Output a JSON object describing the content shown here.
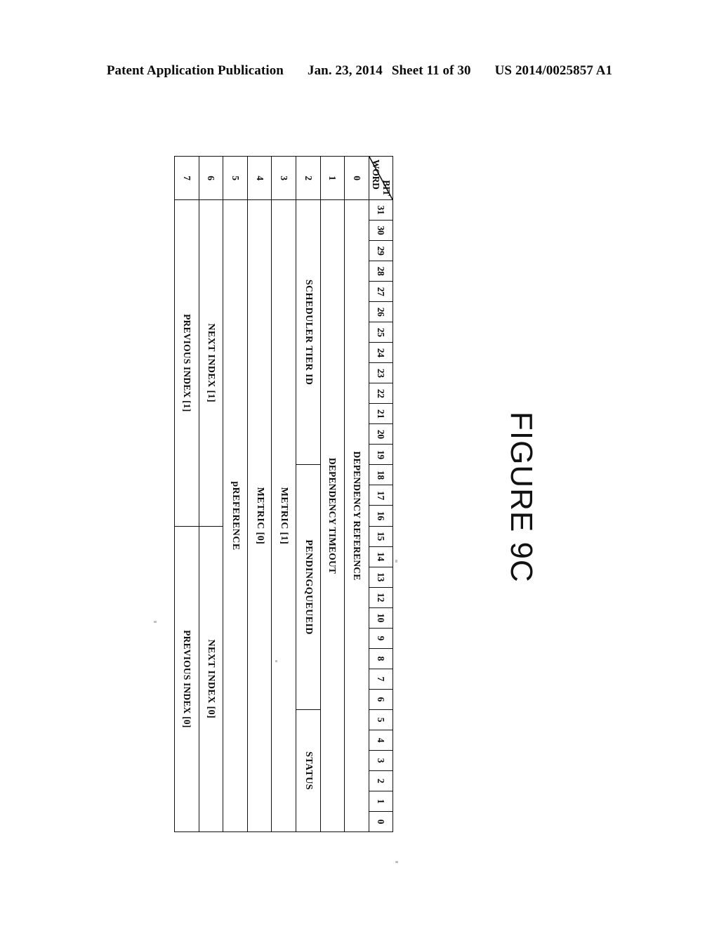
{
  "header": {
    "publication": "Patent Application Publication",
    "date": "Jan. 23, 2014",
    "sheet": "Sheet 11 of 30",
    "patent_number": "US 2014/0025857 A1"
  },
  "figure": {
    "caption": "FIGURE 9C",
    "axis_labels": {
      "word": "WORD",
      "bit": "BIT"
    },
    "bit_numbers": [
      "31",
      "30",
      "29",
      "28",
      "27",
      "26",
      "25",
      "24",
      "23",
      "22",
      "21",
      "20",
      "19",
      "18",
      "17",
      "16",
      "15",
      "14",
      "13",
      "12",
      "10",
      "9",
      "8",
      "7",
      "6",
      "5",
      "4",
      "3",
      "2",
      "1",
      "0"
    ],
    "words": [
      "0",
      "1",
      "2",
      "3",
      "4",
      "5",
      "6",
      "7"
    ],
    "rows": [
      {
        "word": "0",
        "fields": [
          {
            "label": "DEPENDENCY REFERENCE",
            "span": 31
          }
        ]
      },
      {
        "word": "1",
        "fields": [
          {
            "label": "DEPENDENCY TIMEOUT",
            "span": 31
          }
        ]
      },
      {
        "word": "2",
        "fields": [
          {
            "label": "SCHEDULER TIER ID",
            "span": 13
          },
          {
            "label": "PENDINGQUEUEID",
            "span": 12
          },
          {
            "label": "STATUS",
            "span": 6
          }
        ]
      },
      {
        "word": "3",
        "fields": [
          {
            "label": "METRIC [1]",
            "span": 31
          }
        ]
      },
      {
        "word": "4",
        "fields": [
          {
            "label": "METRIC [0]",
            "span": 31
          }
        ]
      },
      {
        "word": "5",
        "fields": [
          {
            "label": "pREFERENCE",
            "span": 31
          }
        ]
      },
      {
        "word": "6",
        "fields": [
          {
            "label": "NEXT INDEX [1]",
            "span": 16
          },
          {
            "label": "NEXT INDEX [0]",
            "span": 15
          }
        ]
      },
      {
        "word": "7",
        "fields": [
          {
            "label": "PREVIOUS INDEX [1]",
            "span": 16
          },
          {
            "label": "PREVIOUS INDEX [0]",
            "span": 15
          }
        ]
      }
    ]
  }
}
